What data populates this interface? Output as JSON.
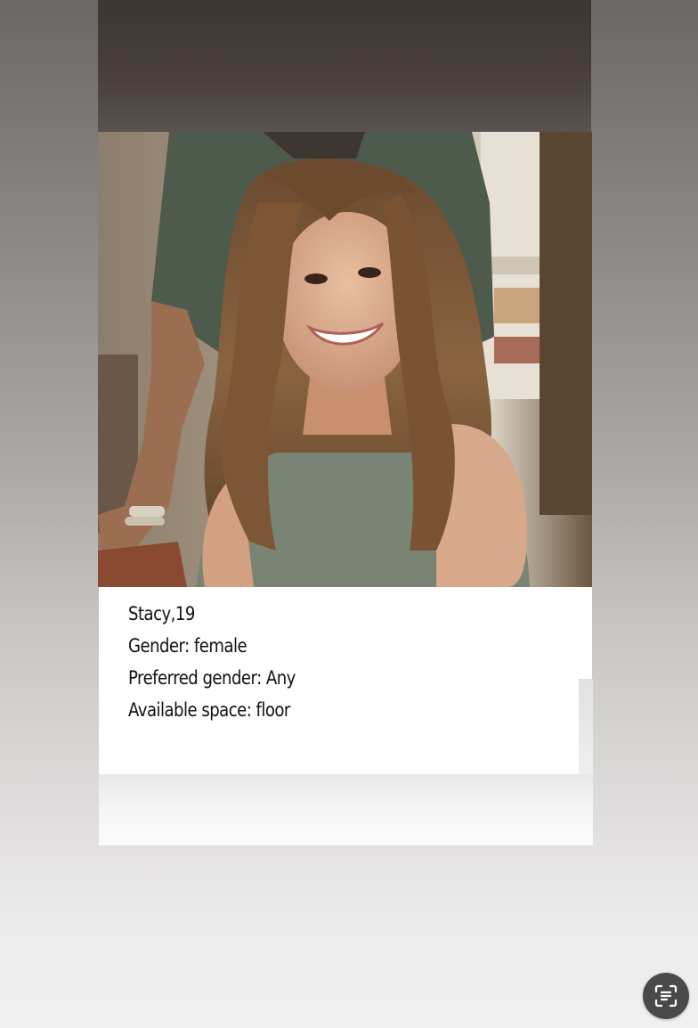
{
  "profile": {
    "name_age": "Stacy,19",
    "gender": "Gender: female",
    "preferred_gender": "Preferred gender: Any",
    "available_space": "Available space: floor"
  },
  "lens_button": {
    "icon": "text-scan-icon"
  }
}
